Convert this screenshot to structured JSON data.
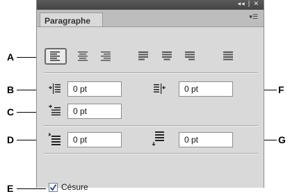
{
  "panel": {
    "window_controls": "◂◂ | ✕",
    "tab_label": "Paragraphe",
    "menu_icon": "panel-menu-icon"
  },
  "alignment": {
    "buttons": [
      {
        "name": "align-left",
        "selected": true
      },
      {
        "name": "align-center",
        "selected": false
      },
      {
        "name": "align-right",
        "selected": false
      },
      {
        "name": "justify-last-left",
        "selected": false
      },
      {
        "name": "justify-last-center",
        "selected": false
      },
      {
        "name": "justify-last-right",
        "selected": false
      },
      {
        "name": "justify-all",
        "selected": false
      }
    ]
  },
  "fields": {
    "left_indent": "0 pt",
    "right_indent": "0 pt",
    "first_line_indent": "0 pt",
    "space_before": "0 pt",
    "space_after": "0 pt"
  },
  "hyphenation": {
    "label": "Césure",
    "checked": true
  },
  "callouts": {
    "a": "A",
    "b": "B",
    "c": "C",
    "d": "D",
    "e": "E",
    "f": "F",
    "g": "G"
  },
  "colors": {
    "panel_bg": "#d9d9d9",
    "titlebar": "#4d4d4d",
    "checkmark": "#2a4fa8"
  }
}
